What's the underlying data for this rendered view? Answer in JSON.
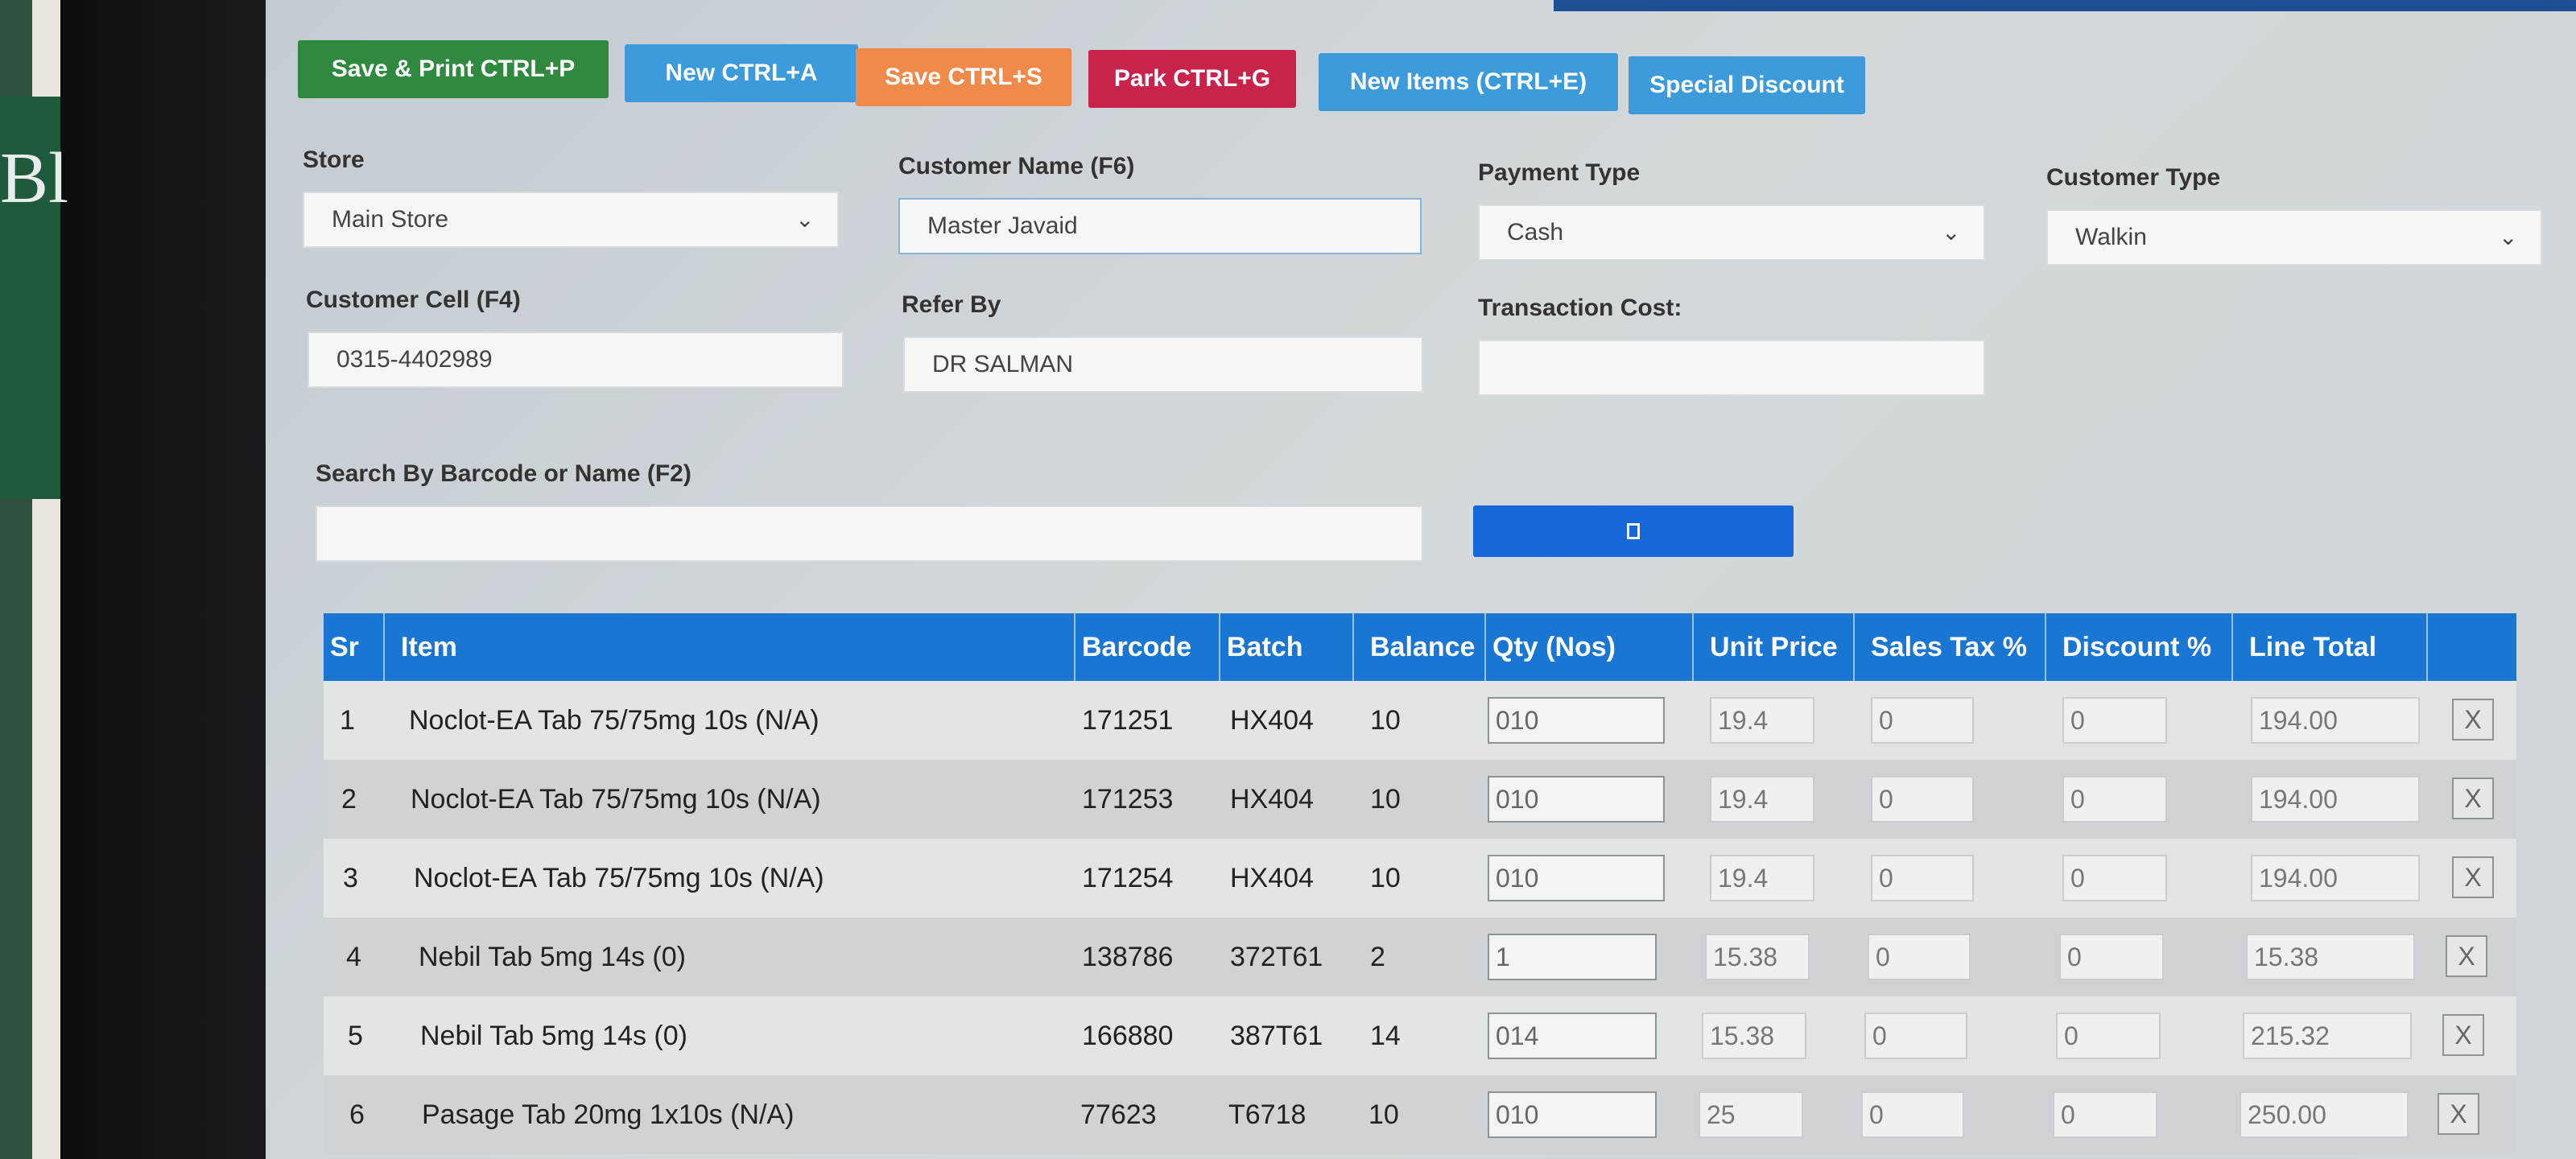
{
  "toolbar": {
    "save_print": "Save & Print CTRL+P",
    "new": "New CTRL+A",
    "save": "Save CTRL+S",
    "park": "Park CTRL+G",
    "new_items": "New Items (CTRL+E)",
    "special_discount": "Special Discount"
  },
  "form": {
    "store_label": "Store",
    "store_value": "Main Store",
    "customer_name_label": "Customer Name (F6)",
    "customer_name_value": "Master Javaid",
    "payment_type_label": "Payment Type",
    "payment_type_value": "Cash",
    "customer_type_label": "Customer Type",
    "customer_type_value": "Walkin",
    "customer_cell_label": "Customer Cell (F4)",
    "customer_cell_value": "0315-4402989",
    "refer_by_label": "Refer By",
    "refer_by_value": "DR SALMAN",
    "transaction_cost_label": "Transaction Cost:",
    "transaction_cost_value": "",
    "search_label": "Search By Barcode or Name (F2)",
    "search_value": ""
  },
  "table": {
    "headers": [
      "Sr",
      "Item",
      "Barcode",
      "Batch",
      "Balance",
      "Qty (Nos)",
      "Unit Price",
      "Sales Tax %",
      "Discount %",
      "Line Total"
    ],
    "remove_label": "X",
    "rows": [
      {
        "sr": "1",
        "item": "Noclot-EA Tab 75/75mg 10s (N/A)",
        "barcode": "171251",
        "batch": "HX404",
        "balance": "10",
        "qty": "010",
        "unit_price": "19.4",
        "sales_tax": "0",
        "discount": "0",
        "line_total": "194.00"
      },
      {
        "sr": "2",
        "item": "Noclot-EA Tab 75/75mg 10s (N/A)",
        "barcode": "171253",
        "batch": "HX404",
        "balance": "10",
        "qty": "010",
        "unit_price": "19.4",
        "sales_tax": "0",
        "discount": "0",
        "line_total": "194.00"
      },
      {
        "sr": "3",
        "item": "Noclot-EA Tab 75/75mg 10s (N/A)",
        "barcode": "171254",
        "batch": "HX404",
        "balance": "10",
        "qty": "010",
        "unit_price": "19.4",
        "sales_tax": "0",
        "discount": "0",
        "line_total": "194.00"
      },
      {
        "sr": "4",
        "item": "Nebil Tab 5mg 14s (0)",
        "barcode": "138786",
        "batch": "372T61",
        "balance": "2",
        "qty": "1",
        "unit_price": "15.38",
        "sales_tax": "0",
        "discount": "0",
        "line_total": "15.38"
      },
      {
        "sr": "5",
        "item": "Nebil Tab 5mg 14s (0)",
        "barcode": "166880",
        "batch": "387T61",
        "balance": "14",
        "qty": "014",
        "unit_price": "15.38",
        "sales_tax": "0",
        "discount": "0",
        "line_total": "215.32"
      },
      {
        "sr": "6",
        "item": "Pasage Tab 20mg 1x10s (N/A)",
        "barcode": "77623",
        "batch": "T6718",
        "balance": "10",
        "qty": "010",
        "unit_price": "25",
        "sales_tax": "0",
        "discount": "0",
        "line_total": "250.00"
      }
    ]
  },
  "icons": {
    "chevron": "chevron-down-icon",
    "search_button": "search-button-icon",
    "remove": "close-icon"
  },
  "colors": {
    "save_print": "#2f8a3f",
    "new": "#3d9bdc",
    "save": "#f08a4b",
    "park": "#c8234a",
    "header": "#1976d2"
  }
}
